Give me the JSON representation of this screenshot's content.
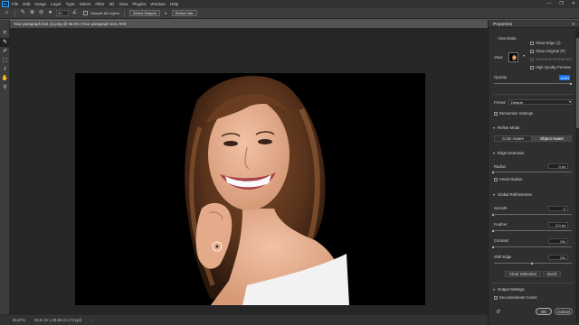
{
  "menubar": {
    "logo": "Ps",
    "items": [
      "File",
      "Edit",
      "Image",
      "Layer",
      "Type",
      "Select",
      "Filter",
      "3D",
      "View",
      "Plugins",
      "Window",
      "Help"
    ],
    "window_controls": [
      "—",
      "❐",
      "✕"
    ]
  },
  "optionsbar": {
    "brush_size": "20",
    "sample_all_layers": "Sample All Layers",
    "select_subject": "Select Subject",
    "refine_hair": "Refine Hair"
  },
  "document": {
    "tab_title": "Your paragraph text (1).png @ 66.6% (Your paragraph text, RGB/8#) *"
  },
  "statusbar": {
    "zoom": "66.67%",
    "dimensions": "50.8 cm x 28.58 cm (72 ppi)"
  },
  "properties": {
    "tab_label": "Properties",
    "menu_icon": "≡",
    "view_mode_heading": "View Mode",
    "view_label": "View:",
    "show_edge": "Show Edge (J)",
    "show_original": "Show Original (P)",
    "realtime_refinement": "Real-time Refinement",
    "high_quality_preview": "High Quality Preview",
    "opacity_label": "Opacity",
    "opacity_value": "100%",
    "opacity_fraction": 1.0,
    "preset_label": "Preset:",
    "preset_value": "Default",
    "remember_settings": "Remember Settings",
    "refine_mode_heading": "Refine Mode",
    "color_aware": "Color Aware",
    "object_aware": "Object Aware",
    "edge_detection_heading": "Edge Detection",
    "radius_label": "Radius",
    "radius_value": "0 px",
    "radius_fraction": 0.0,
    "smart_radius": "Smart Radius",
    "global_refinements_heading": "Global Refinements",
    "smooth_label": "Smooth",
    "smooth_value": "0",
    "smooth_fraction": 0.0,
    "feather_label": "Feather",
    "feather_value": "0.0 px",
    "feather_fraction": 0.0,
    "contrast_label": "Contrast",
    "contrast_value": "0%",
    "contrast_fraction": 0.0,
    "shift_edge_label": "Shift Edge",
    "shift_edge_value": "0%",
    "shift_edge_fraction": 0.5,
    "clear_selection": "Clear Selection",
    "invert": "Invert",
    "output_settings_heading": "Output Settings",
    "decontaminate_colors": "Decontaminate Colors",
    "ok": "OK",
    "cancel": "Cancel"
  },
  "colors": {
    "accent": "#1473e6",
    "canvas_bg": "#000000",
    "workspace": "#262626"
  }
}
